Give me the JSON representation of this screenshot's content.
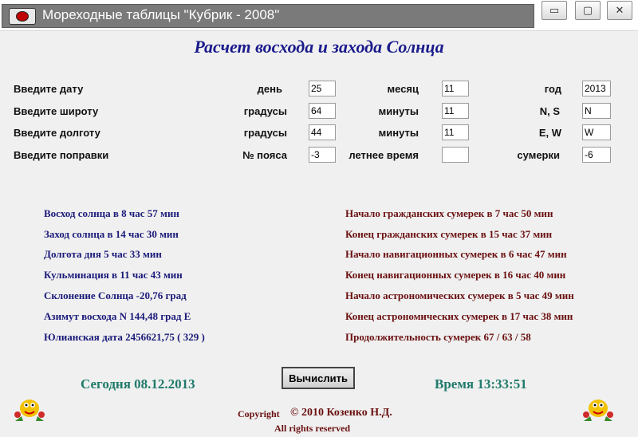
{
  "window": {
    "title": "Мореходные таблицы \"Кубрик - 2008\"",
    "buttons": {
      "minimize": "▭",
      "maximize": "▢",
      "close": "✕"
    }
  },
  "heading": "Расчет восхода и захода Солнца",
  "inputs": {
    "row1": {
      "label": "Введите дату",
      "f1_label": "день",
      "f1": "25",
      "f2_label": "месяц",
      "f2": "11",
      "f3_label": "год",
      "f3": "2013"
    },
    "row2": {
      "label": "Введите широту",
      "f1_label": "градусы",
      "f1": "64",
      "f2_label": "минуты",
      "f2": "11",
      "f3_label": "N, S",
      "f3": "N"
    },
    "row3": {
      "label": "Введите долготу",
      "f1_label": "градусы",
      "f1": "44",
      "f2_label": "минуты",
      "f2": "11",
      "f3_label": "E, W",
      "f3": "W"
    },
    "row4": {
      "label": "Введите поправки",
      "f1_label": "№ пояса",
      "f1": "-3",
      "f2_label": "летнее время",
      "f2": "",
      "f3_label": "сумерки",
      "f3": "-6"
    }
  },
  "results_left": [
    "Восход солнца в 8 час 57 мин",
    "Заход солнца в 14 час 30 мин",
    "Долгота дня 5 час 33 мин",
    "Кульминация в 11 час 43 мин",
    "Склонение Солнца -20,76 град",
    "Азимут восхода N 144,48 град E",
    "Юлианская дата 2456621,75 ( 329 )"
  ],
  "results_right": [
    "Начало гражданских сумерек в 7 час 50 мин",
    "Конец гражданских сумерек в 15 час 37 мин",
    "Начало навигационных сумерек в 6 час 47 мин",
    "Конец навигационных сумерек в 16 час 40 мин",
    "Начало астрономических сумерек в 5 час 49 мин",
    "Конец астрономических сумерек в 17 час 38 мин",
    "Продолжительность сумерек  67 / 63 / 58"
  ],
  "footer": {
    "today": "Сегодня 08.12.2013",
    "time": "Время 13:33:51",
    "calculate": "Вычислить",
    "copyright_label": "Copyright",
    "copyright_text": "© 2010 Козенко Н.Д.",
    "rights": "All rights reserved"
  },
  "colors": {
    "heading": "#1a1a8c",
    "results_left": "#1a1a7a",
    "results_right": "#6b1010",
    "status": "#1f7a6a"
  }
}
